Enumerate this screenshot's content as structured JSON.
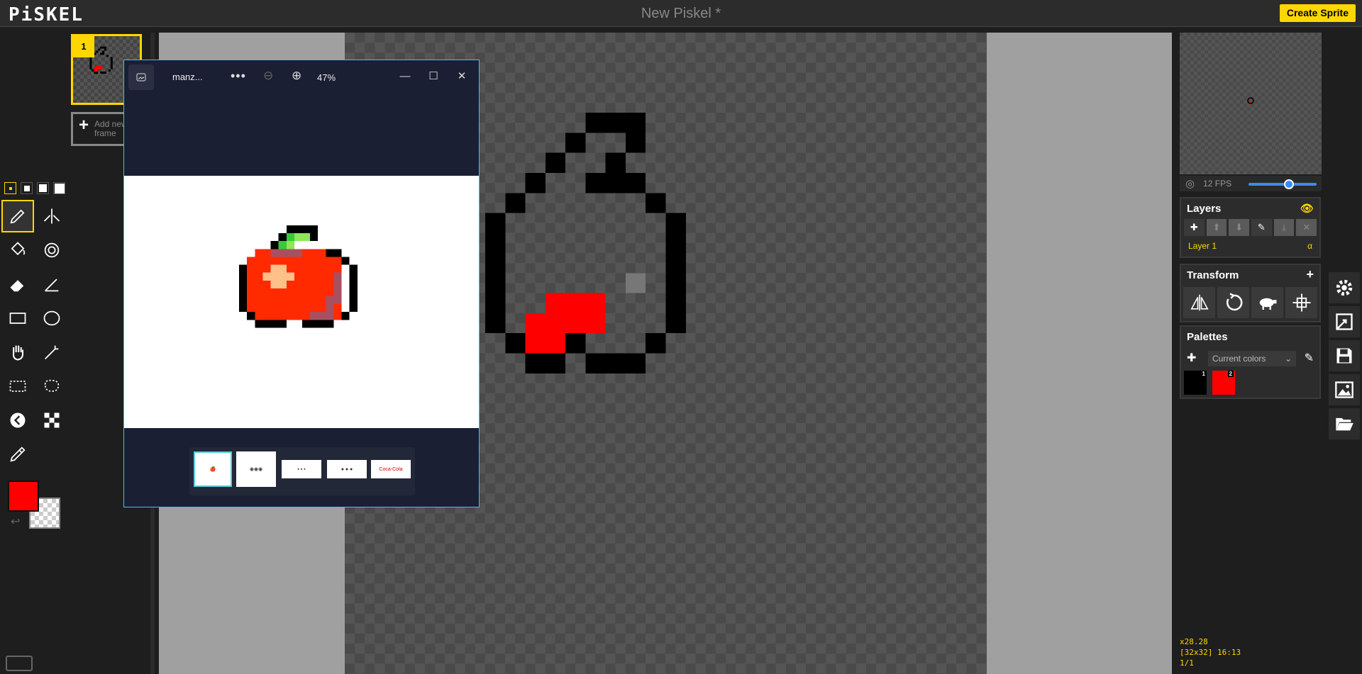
{
  "app": {
    "logo": "PiSKEL",
    "title": "New Piskel *",
    "create_button": "Create Sprite"
  },
  "frames": {
    "items": [
      {
        "index": "1"
      }
    ],
    "add_frame_label": "Add new frame"
  },
  "pen_sizes": [
    1,
    2,
    3,
    4
  ],
  "tools": [
    "pen-tool",
    "vertical-mirror-pen-tool",
    "paint-bucket-tool",
    "paint-all-same-color-tool",
    "eraser-tool",
    "stroke-tool",
    "rectangle-tool",
    "circle-tool",
    "move-tool",
    "shape-selection-tool",
    "rectangle-selection-tool",
    "lasso-selection-tool",
    "lighten-tool",
    "dithering-tool",
    "color-picker-tool"
  ],
  "colors": {
    "primary": "#ff0000",
    "secondary": "transparent"
  },
  "viewer": {
    "file_name": "manz...",
    "zoom_level": "47%",
    "thumbnails": [
      "apple",
      "burger logos",
      "brand logos",
      "social logos",
      "coca-cola disney"
    ]
  },
  "preview": {
    "fps_label": "12 FPS",
    "fps_value": 12
  },
  "layers": {
    "title": "Layers",
    "items": [
      {
        "name": "Layer 1",
        "alpha": "α"
      }
    ]
  },
  "transform": {
    "title": "Transform"
  },
  "palettes": {
    "title": "Palettes",
    "current": "Current colors",
    "swatches": [
      {
        "index": "1",
        "color": "#000000"
      },
      {
        "index": "2",
        "color": "#ff0000"
      }
    ]
  },
  "status": {
    "cursor": "x28.28",
    "size_info": "[32x32] 16:13",
    "frame_info": "1/1"
  }
}
